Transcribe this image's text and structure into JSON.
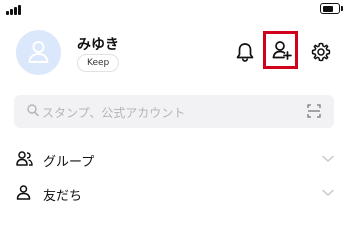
{
  "status_bar": {
    "signal_icon": "signal-bars-icon",
    "battery_icon": "battery-icon"
  },
  "profile": {
    "name": "みゆき",
    "keep_label": "Keep",
    "avatar_icon": "person-silhouette-icon"
  },
  "header_actions": {
    "notifications_icon": "bell-icon",
    "add_friend_icon": "add-person-icon",
    "add_friend_highlight_color": "#d0021b",
    "settings_icon": "gear-icon"
  },
  "search": {
    "placeholder": "スタンプ、公式アカウント",
    "search_icon": "search-icon",
    "scan_icon": "qr-scan-icon"
  },
  "list": {
    "items": [
      {
        "label": "グループ",
        "icon": "group-icon",
        "expand_icon": "chevron-down-icon"
      },
      {
        "label": "友だち",
        "icon": "person-icon",
        "expand_icon": "chevron-down-icon"
      }
    ]
  },
  "colors": {
    "avatar_bg": "#dbe7fb",
    "search_bg": "#f2f2f4",
    "placeholder": "#b4b4b8"
  }
}
